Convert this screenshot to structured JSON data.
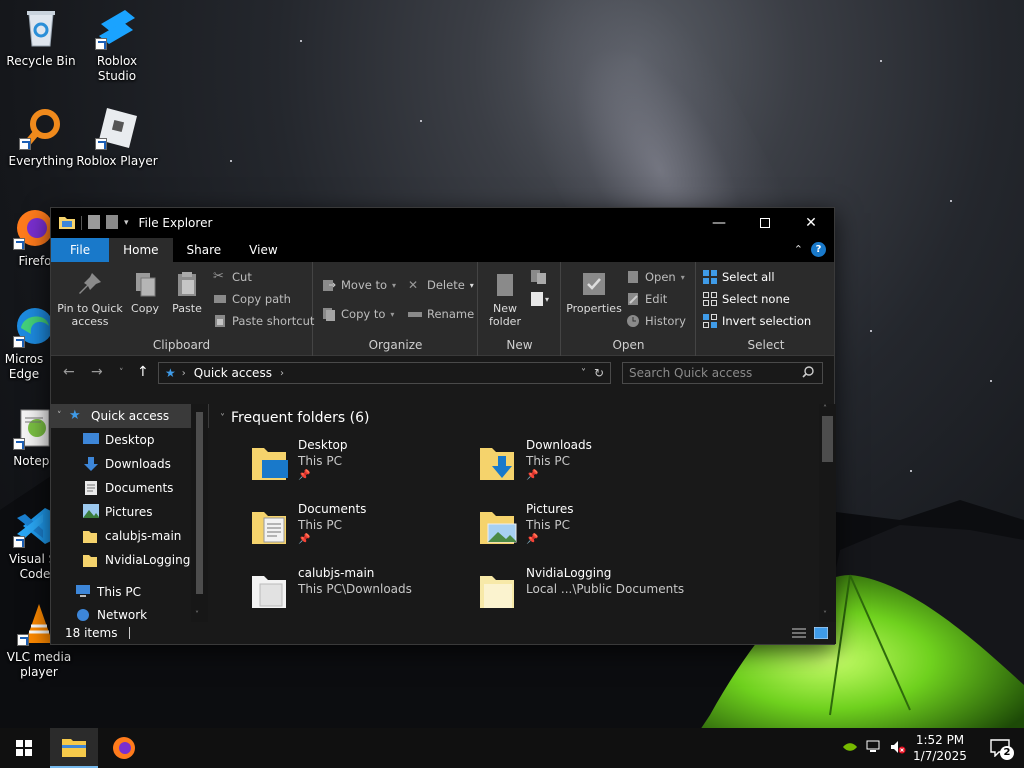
{
  "desktop": {
    "icons": [
      {
        "label": "Recycle Bin"
      },
      {
        "label": "Roblox Studio"
      },
      {
        "label": "Everything"
      },
      {
        "label": "Roblox Player"
      },
      {
        "label": "Firefo"
      },
      {
        "label": "Micros Edge"
      },
      {
        "label": "Notepa"
      },
      {
        "label": "Visual St Code"
      },
      {
        "label": "VLC media player"
      }
    ]
  },
  "window": {
    "title": "File Explorer",
    "tabs": {
      "file": "File",
      "home": "Home",
      "share": "Share",
      "view": "View"
    },
    "help": "?",
    "ribbon": {
      "clipboard": {
        "group": "Clipboard",
        "pin": "Pin to Quick access",
        "copy": "Copy",
        "paste": "Paste",
        "cut": "Cut",
        "copy_path": "Copy path",
        "paste_shortcut": "Paste shortcut"
      },
      "organize": {
        "group": "Organize",
        "move_to": "Move to",
        "copy_to": "Copy to",
        "delete": "Delete",
        "rename": "Rename"
      },
      "new": {
        "group": "New",
        "new_folder": "New folder"
      },
      "open": {
        "group": "Open",
        "properties": "Properties",
        "open": "Open",
        "edit": "Edit",
        "history": "History"
      },
      "select": {
        "group": "Select",
        "select_all": "Select all",
        "select_none": "Select none",
        "invert": "Invert selection"
      }
    },
    "address": {
      "crumb": "Quick access",
      "search_placeholder": "Search Quick access"
    },
    "nav": {
      "quick_access": "Quick access",
      "items": [
        {
          "label": "Desktop",
          "pinned": "📌"
        },
        {
          "label": "Downloads",
          "pinned": "📌"
        },
        {
          "label": "Documents",
          "pinned": "📌"
        },
        {
          "label": "Pictures",
          "pinned": "📌"
        },
        {
          "label": "calubjs-main",
          "pinned": ""
        },
        {
          "label": "NvidiaLogging",
          "pinned": ""
        }
      ],
      "this_pc": "This PC",
      "network": "Network"
    },
    "content": {
      "group_title": "Frequent folders (6)",
      "tiles": [
        {
          "name": "Desktop",
          "sub": "This PC",
          "pin": "📌"
        },
        {
          "name": "Downloads",
          "sub": "This PC",
          "pin": "📌"
        },
        {
          "name": "Documents",
          "sub": "This PC",
          "pin": "📌"
        },
        {
          "name": "Pictures",
          "sub": "This PC",
          "pin": "📌"
        },
        {
          "name": "calubjs-main",
          "sub": "This PC\\Downloads",
          "pin": ""
        },
        {
          "name": "NvidiaLogging",
          "sub": "Local ...\\Public Documents",
          "pin": ""
        }
      ]
    },
    "status": {
      "items": "18 items"
    }
  },
  "taskbar": {
    "time": "1:52 PM",
    "date": "1/7/2025",
    "notifications": "2"
  },
  "colors": {
    "accent": "#1979ca",
    "ribbon": "#2b2b2b",
    "window_bg": "#191919",
    "folder": "#f5d36c"
  }
}
